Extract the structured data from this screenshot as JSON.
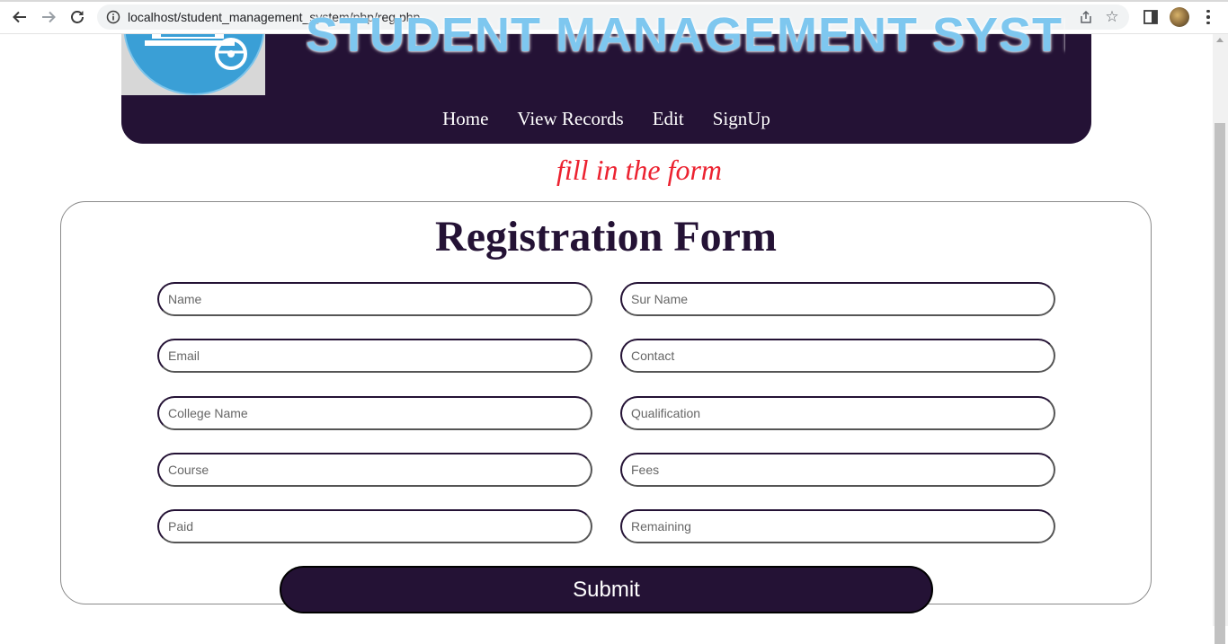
{
  "browser": {
    "url": "localhost/student_management_system/php/reg.php"
  },
  "header": {
    "site_title": "STUDENT MANAGEMENT SYSTEM",
    "nav": [
      "Home",
      "View Records",
      "Edit",
      "SignUp"
    ]
  },
  "page": {
    "subtitle": "fill in the form",
    "form_title": "Registration Form",
    "fields": {
      "name": "Name",
      "surname": "Sur Name",
      "email": "Email",
      "contact": "Contact",
      "college": "College Name",
      "qualification": "Qualification",
      "course": "Course",
      "fees": "Fees",
      "paid": "Paid",
      "remaining": "Remaining"
    },
    "submit_label": "Submit"
  },
  "colors": {
    "header_bg": "#241235",
    "subtitle": "#ec2230",
    "title_text": "#241235"
  }
}
